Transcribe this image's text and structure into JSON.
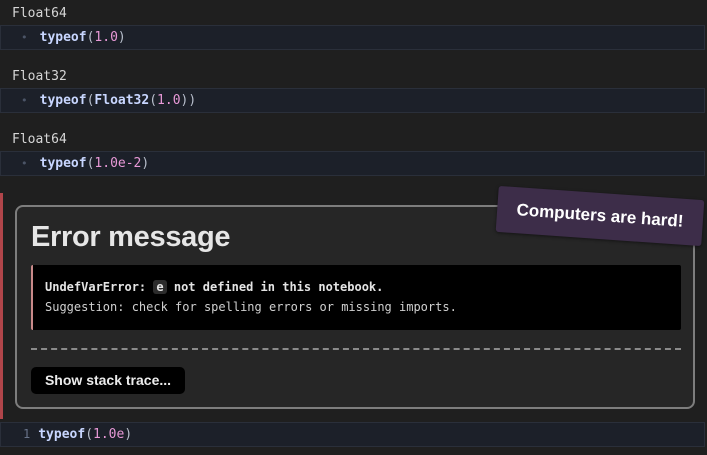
{
  "cells": [
    {
      "output": "Float64",
      "code": {
        "fn": "typeof",
        "open": "(",
        "inner_fn": "",
        "inner_open": "",
        "arg": "1.0",
        "inner_close": "",
        "close": ")"
      }
    },
    {
      "output": "Float32",
      "code": {
        "fn": "typeof",
        "open": "(",
        "inner_fn": "Float32",
        "inner_open": "(",
        "arg": "1.0",
        "inner_close": ")",
        "close": ")"
      }
    },
    {
      "output": "Float64",
      "code": {
        "fn": "typeof",
        "open": "(",
        "inner_fn": "",
        "inner_open": "",
        "arg": "1.0e-2",
        "inner_close": "",
        "close": ")"
      }
    }
  ],
  "error": {
    "title": "Error message",
    "line1_prefix": "UndefVarError:",
    "line1_var": "e",
    "line1_suffix": "not defined in this notebook.",
    "line2": "Suggestion: check for spelling errors or missing imports.",
    "button": "Show stack trace..."
  },
  "sticker": "Computers are hard!",
  "last_cell": {
    "line_number": "1",
    "fn": "typeof",
    "open": "(",
    "arg": "1.0e",
    "close": ")"
  }
}
